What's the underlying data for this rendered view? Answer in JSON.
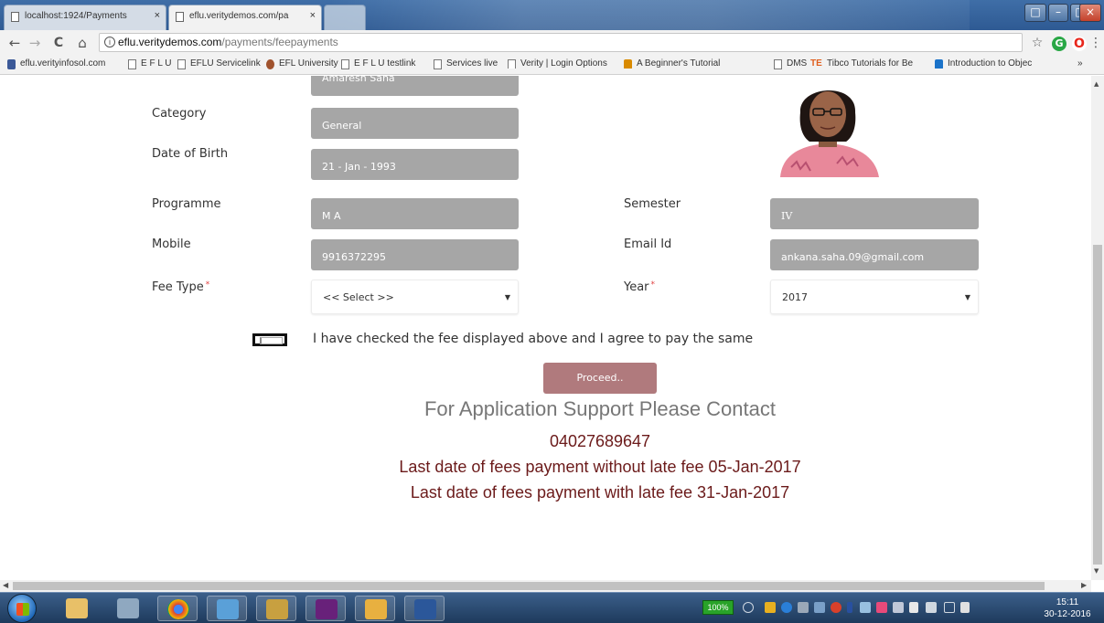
{
  "browser": {
    "tabs": [
      {
        "title": "localhost:1924/Payments"
      },
      {
        "title": "eflu.veritydemos.com/pa"
      }
    ],
    "close_glyph": "×",
    "window_controls": {
      "minimize": "–",
      "maximize": "□",
      "close": "×"
    },
    "nav": {
      "back": "←",
      "forward": "→",
      "reload": "C",
      "home": "⌂"
    },
    "address": {
      "host": "eflu.veritydemos.com",
      "path": "/payments/feepayments",
      "info_glyph": "i"
    },
    "star_glyph": "☆",
    "menu_glyph": "⋮",
    "extensions": [
      {
        "glyph": "G",
        "color": "#28a745"
      },
      {
        "glyph": "O",
        "color": "#e8271c"
      }
    ],
    "bookmarks": [
      {
        "label": "eflu.verityinfosol.com",
        "icon_color": "#3b5998"
      },
      {
        "label": "E F L U"
      },
      {
        "label": "EFLU Servicelink"
      },
      {
        "label": "EFL University",
        "icon_color": "#a0522d"
      },
      {
        "label": "E F L U testlink"
      },
      {
        "label": "Services live"
      },
      {
        "label": "Verity | Login Options"
      },
      {
        "label": "A Beginner's Tutorial",
        "icon_color": "#d98a00"
      },
      {
        "label": "DMS"
      },
      {
        "label": "Tibco Tutorials for Be",
        "icon_prefix": "TE",
        "icon_color": "#e06020"
      },
      {
        "label": "Introduction to Objec",
        "icon_color": "#1b73c9"
      }
    ],
    "bookmarks_overflow": "»"
  },
  "form": {
    "name_value": "Amaresh Saha",
    "category": {
      "label": "Category",
      "value": "General"
    },
    "dob": {
      "label": "Date of Birth",
      "value": "21 - Jan - 1993"
    },
    "programme": {
      "label": "Programme",
      "value": "M A"
    },
    "semester": {
      "label": "Semester",
      "value": "IV"
    },
    "mobile": {
      "label": "Mobile",
      "value": "9916372295"
    },
    "email": {
      "label": "Email Id",
      "value": "ankana.saha.09@gmail.com"
    },
    "fee_type": {
      "label": "Fee Type",
      "required_mark": "*",
      "selected": "<< Select >>"
    },
    "year": {
      "label": "Year",
      "required_mark": "*",
      "selected": "2017"
    },
    "caret_glyph": "▼",
    "agree_text": "I have checked the fee displayed above and I agree to pay the same",
    "proceed_label": "Proceed.."
  },
  "support": {
    "title": "For Application Support Please Contact",
    "phone": "04027689647",
    "last_date_without_late_fee": "Last date of fees payment without late fee 05-Jan-2017",
    "last_date_with_late_fee": "Last date of fees payment with late fee 31-Jan-2017"
  },
  "scroll_arrows": {
    "up": "▲",
    "down": "▼",
    "left": "◀",
    "right": "▶"
  },
  "taskbar": {
    "battery_badge": "100%",
    "clock_time": "15:11",
    "clock_date": "30-12-2016",
    "apps": [
      {
        "name": "explorer",
        "color": "#e8c068"
      },
      {
        "name": "calculator",
        "color": "#8fa8c0"
      },
      {
        "name": "chrome",
        "color": "#db4437"
      },
      {
        "name": "folder-sync",
        "color": "#5aa0d8"
      },
      {
        "name": "tools",
        "color": "#c8a040"
      },
      {
        "name": "visual-studio",
        "color": "#68217a"
      },
      {
        "name": "certificate",
        "color": "#e8b040"
      },
      {
        "name": "word",
        "color": "#2b579a"
      }
    ]
  }
}
